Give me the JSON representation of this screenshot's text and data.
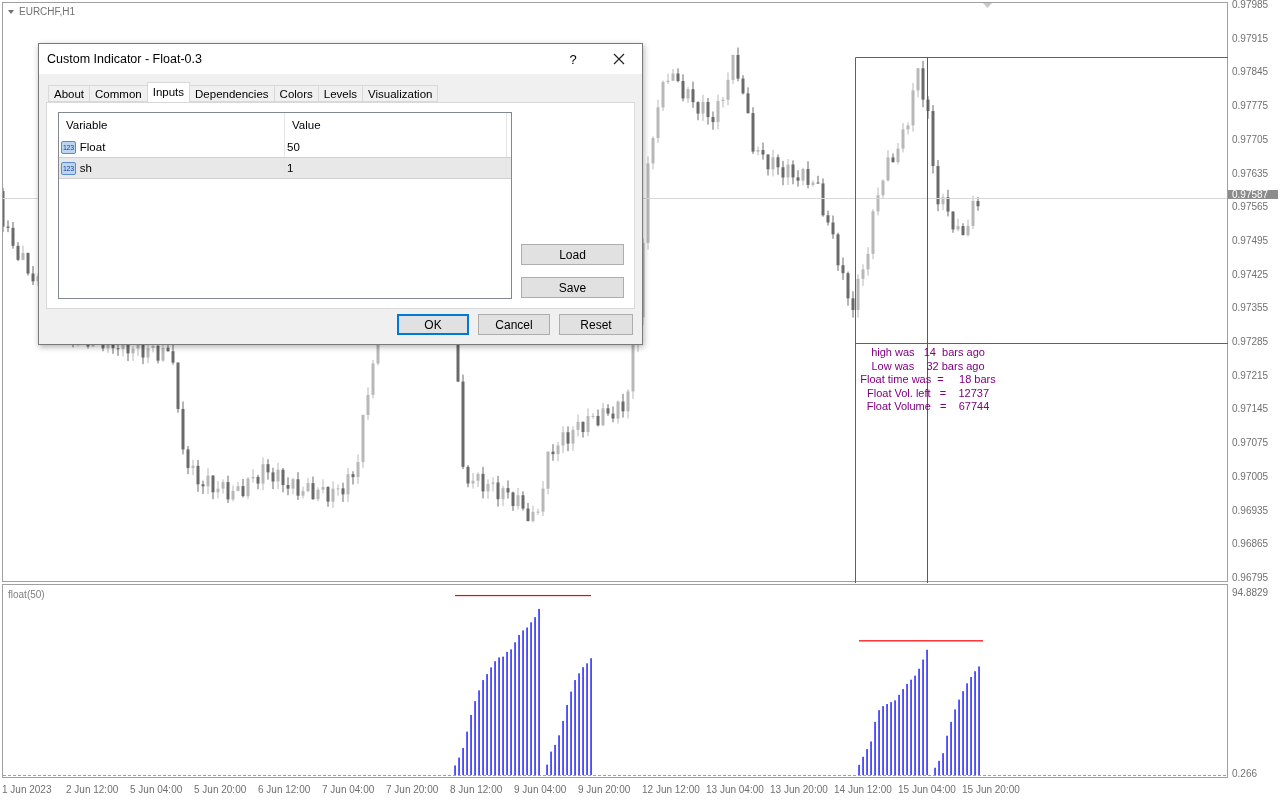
{
  "chart": {
    "symbol": "EURCHF,H1",
    "current_price": "0.97587",
    "price_axis": [
      "0.97985",
      "0.97915",
      "0.97845",
      "0.97775",
      "0.97705",
      "0.97635",
      "0.97565",
      "0.97495",
      "0.97425",
      "0.97355",
      "0.97285",
      "0.97215",
      "0.97145",
      "0.97075",
      "0.97005",
      "0.96935",
      "0.96865",
      "0.96795"
    ],
    "info_lines": [
      "high was   14  bars ago",
      "Low was    32 bars ago",
      "Float time was  =     18 bars",
      "Float Vol. left   =    12737",
      "Float Volume   =    67744"
    ]
  },
  "indicator": {
    "label": "float(50)",
    "scale_max": "94.8829",
    "scale_min": "0.266"
  },
  "time_axis": [
    "1 Jun 2023",
    "2 Jun 12:00",
    "5 Jun 04:00",
    "5 Jun 20:00",
    "6 Jun 12:00",
    "7 Jun 04:00",
    "7 Jun 20:00",
    "8 Jun 12:00",
    "9 Jun 04:00",
    "9 Jun 20:00",
    "12 Jun 12:00",
    "13 Jun 04:00",
    "13 Jun 20:00",
    "14 Jun 12:00",
    "15 Jun 04:00",
    "15 Jun 20:00"
  ],
  "dialog": {
    "title": "Custom Indicator - Float-0.3",
    "help": "?",
    "tabs": [
      {
        "label": "About",
        "selected": false
      },
      {
        "label": "Common",
        "selected": false
      },
      {
        "label": "Inputs",
        "selected": true
      },
      {
        "label": "Dependencies",
        "selected": false
      },
      {
        "label": "Colors",
        "selected": false
      },
      {
        "label": "Levels",
        "selected": false
      },
      {
        "label": "Visualization",
        "selected": false
      }
    ],
    "columns": [
      "Variable",
      "Value"
    ],
    "rows": [
      {
        "type_badge": "123",
        "variable": "Float",
        "value": "50",
        "selected": false
      },
      {
        "type_badge": "123",
        "variable": "sh",
        "value": "1",
        "selected": true
      }
    ],
    "side_buttons": [
      "Load",
      "Save"
    ],
    "buttons": [
      {
        "label": "OK",
        "default": true
      },
      {
        "label": "Cancel",
        "default": false
      },
      {
        "label": "Reset",
        "default": false
      }
    ]
  }
}
